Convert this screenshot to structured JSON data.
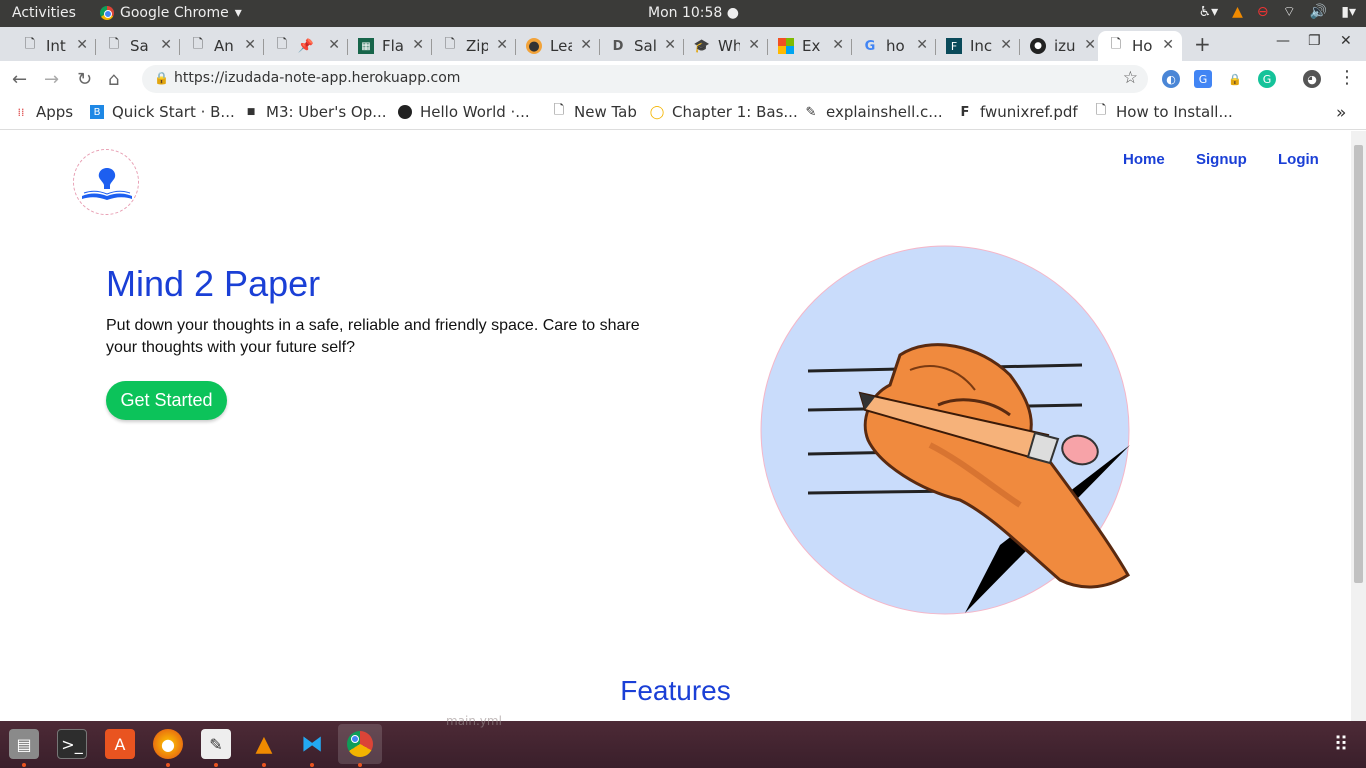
{
  "system": {
    "activities": "Activities",
    "app_name": "Google Chrome",
    "clock": "Mon 10:58"
  },
  "tabs": [
    {
      "title": "Int",
      "favicon": "doc-icon"
    },
    {
      "title": "Sa",
      "favicon": "doc-icon"
    },
    {
      "title": "An",
      "favicon": "doc-icon"
    },
    {
      "title": "",
      "favicon": "pin-icon"
    },
    {
      "title": "Fla",
      "favicon": "grid-icon"
    },
    {
      "title": "Zip",
      "favicon": "doc-icon"
    },
    {
      "title": "Lea",
      "favicon": "ninja-icon"
    },
    {
      "title": "Sal",
      "favicon": "d-icon"
    },
    {
      "title": "Wh",
      "favicon": "hat-icon"
    },
    {
      "title": "Ex",
      "favicon": "windows-icon"
    },
    {
      "title": "ho",
      "favicon": "google-icon"
    },
    {
      "title": "Inc",
      "favicon": "f-icon"
    },
    {
      "title": "izu",
      "favicon": "github-icon"
    },
    {
      "title": "Ho",
      "favicon": "doc-icon"
    }
  ],
  "address": {
    "url": "https://izudada-note-app.herokuapp.com"
  },
  "bookmarks": [
    {
      "label": "Apps",
      "icon": "apps-grid-icon"
    },
    {
      "label": "Quick Start · B...",
      "icon": "b-icon"
    },
    {
      "label": "M3: Uber's Op...",
      "icon": "square-icon"
    },
    {
      "label": "Hello World ·...",
      "icon": "github-icon"
    },
    {
      "label": "New Tab",
      "icon": "doc-icon"
    },
    {
      "label": "Chapter 1: Bas...",
      "icon": "ring-icon"
    },
    {
      "label": "explainshell.c...",
      "icon": "shell-icon"
    },
    {
      "label": "fwunixref.pdf",
      "icon": "f-icon"
    },
    {
      "label": "How to Install...",
      "icon": "doc-icon"
    }
  ],
  "site": {
    "nav": [
      "Home",
      "Signup",
      "Login"
    ],
    "title": "Mind 2 Paper",
    "subtitle": "Put down your thoughts in a safe, reliable and friendly space. Care to share your thoughts with your future self?",
    "cta": "Get Started",
    "section_heading": "Features"
  },
  "dock_ghost_text": "main.yml",
  "colors": {
    "accent": "#1a3fd6",
    "cta": "#0cc35a",
    "circle": "#c9dcfb"
  }
}
